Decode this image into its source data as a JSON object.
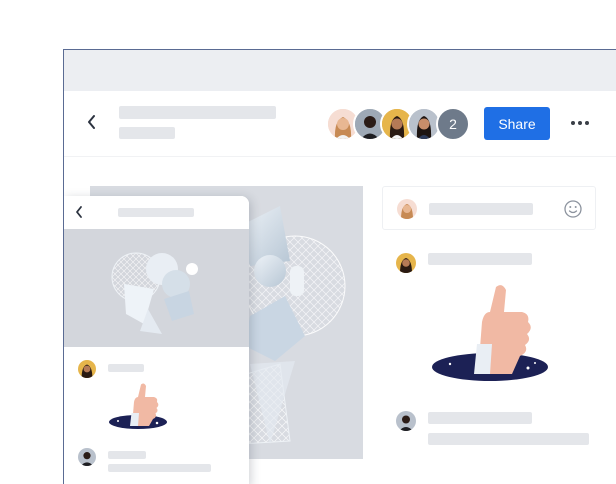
{
  "app": {
    "share_label": "Share",
    "collaborator_extra_count": "2"
  },
  "icons": {
    "back": "chevron-left-icon",
    "more": "ellipsis-icon",
    "emoji": "smiley-icon",
    "reaction": "thumbs-up-sticker"
  },
  "colors": {
    "accent": "#1f6fe5",
    "window_border": "#5a6b93",
    "placeholder": "#e4e6ea",
    "canvas_bg": "#d8dbe1",
    "portal": "#1c2155"
  }
}
